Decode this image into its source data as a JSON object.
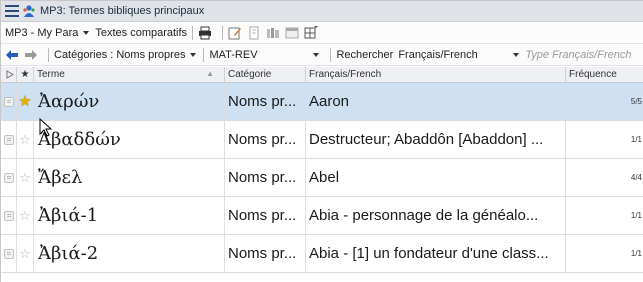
{
  "window": {
    "title": "MP3: Termes bibliques principaux"
  },
  "toolbar1": {
    "resource": "MP3 - My Para",
    "comparative": "Textes comparatifs"
  },
  "toolbar2": {
    "categories": "Catégories : Noms propres",
    "range": "MAT-REV",
    "search_label": "Rechercher",
    "language": "Français/French",
    "type_placeholder": "Type Français/French"
  },
  "columns": {
    "term": "Terme",
    "category": "Catégorie",
    "gloss": "Français/French",
    "frequency": "Fréquence"
  },
  "rows": [
    {
      "term": "Ἀαρών",
      "category": "Noms pr...",
      "gloss": "Aaron",
      "freq": "5/5",
      "starred": true,
      "selected": true
    },
    {
      "term": "Ἀβαδδών",
      "category": "Noms pr...",
      "gloss": "Destructeur; Abaddôn [Abaddon] ...",
      "freq": "1/1",
      "starred": false,
      "selected": false
    },
    {
      "term": "Ἄβελ",
      "category": "Noms pr...",
      "gloss": "Abel",
      "freq": "4/4",
      "starred": false,
      "selected": false
    },
    {
      "term": "Ἀβιά-1",
      "category": "Noms pr...",
      "gloss": "Abia - personnage de la généalo...",
      "freq": "1/1",
      "starred": false,
      "selected": false
    },
    {
      "term": "Ἀβιά-2",
      "category": "Noms pr...",
      "gloss": "Abia - [1] un fondateur d'une class...",
      "freq": "1/1",
      "starred": false,
      "selected": false
    }
  ],
  "colors": {
    "selected_row": "#cfe0f3",
    "star_on": "#e2b400"
  }
}
